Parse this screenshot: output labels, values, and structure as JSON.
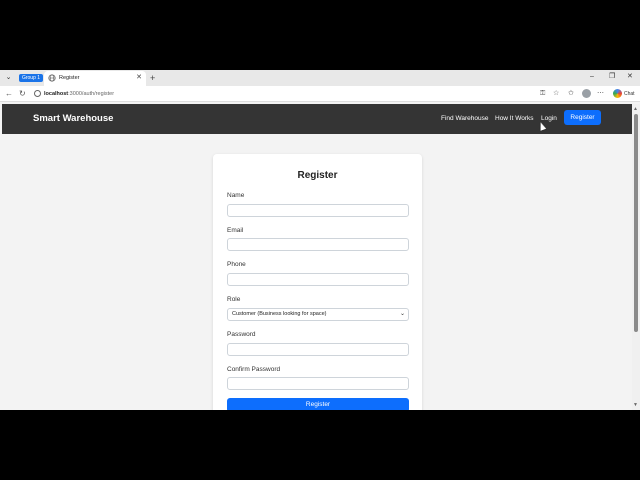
{
  "browser": {
    "tab_group_label": "Group 1",
    "tab_title": "Register",
    "url_host": "localhost",
    "url_path": ":3000/auth/register",
    "chat_label": "Chat"
  },
  "site": {
    "brand": "Smart Warehouse",
    "nav": {
      "find": "Find Warehouse",
      "how": "How It Works",
      "login": "Login",
      "register": "Register"
    }
  },
  "form": {
    "title": "Register",
    "fields": [
      {
        "label": "Name",
        "value": ""
      },
      {
        "label": "Email",
        "value": ""
      },
      {
        "label": "Phone",
        "value": ""
      },
      {
        "label": "Role",
        "value": "Customer (Business looking for space)"
      },
      {
        "label": "Password",
        "value": ""
      },
      {
        "label": "Confirm Password",
        "value": ""
      }
    ],
    "submit_label": "Register"
  },
  "colors": {
    "navbar": "#343434",
    "primary": "#0d6efd",
    "tab_group": "#1a73e8"
  }
}
